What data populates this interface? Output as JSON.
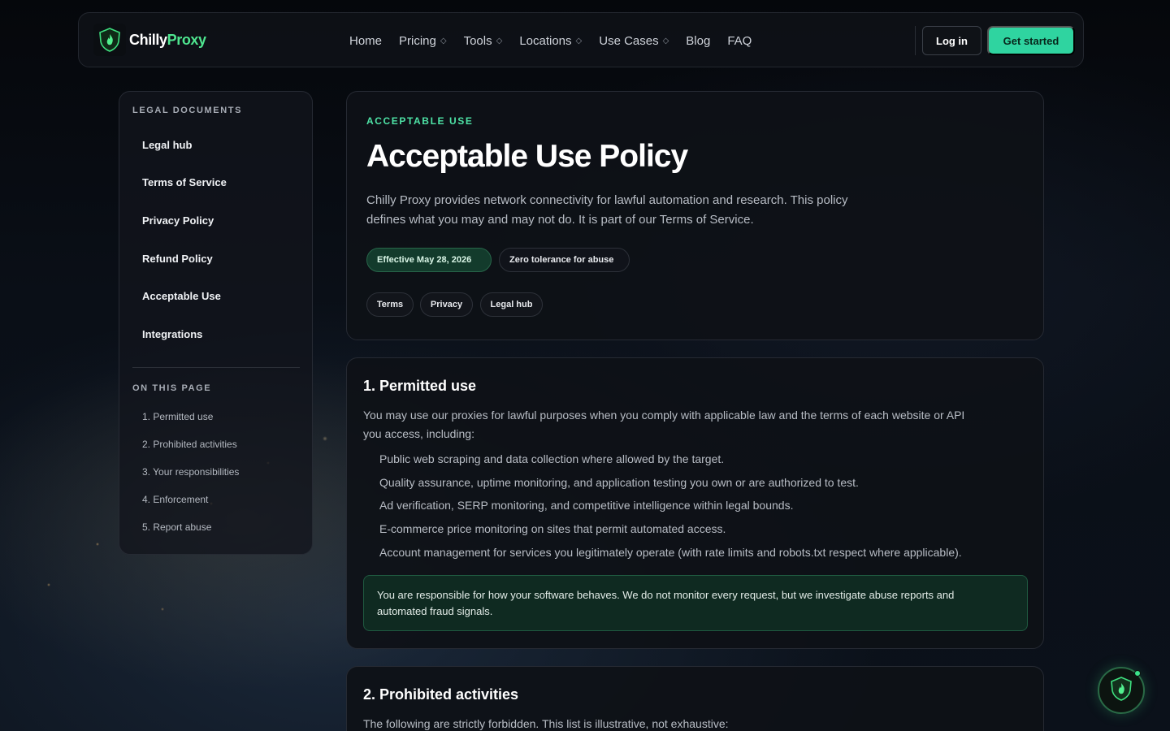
{
  "header": {
    "logo_part1": "Chilly",
    "logo_part2": "Proxy",
    "nav": [
      {
        "label": "Home",
        "dropdown": false
      },
      {
        "label": "Pricing",
        "dropdown": true
      },
      {
        "label": "Tools",
        "dropdown": true
      },
      {
        "label": "Locations",
        "dropdown": true
      },
      {
        "label": "Use Cases",
        "dropdown": true
      },
      {
        "label": "Blog",
        "dropdown": false
      },
      {
        "label": "FAQ",
        "dropdown": false
      }
    ],
    "login_label": "Log in",
    "cta_label": "Get started"
  },
  "sidebar": {
    "docs_heading": "LEGAL DOCUMENTS",
    "docs": [
      "Legal hub",
      "Terms of Service",
      "Privacy Policy",
      "Refund Policy",
      "Acceptable Use",
      "Integrations"
    ],
    "toc_heading": "ON THIS PAGE",
    "toc": [
      "1. Permitted use",
      "2. Prohibited activities",
      "3. Your responsibilities",
      "4. Enforcement",
      "5. Report abuse"
    ]
  },
  "hero": {
    "eyebrow": "ACCEPTABLE USE",
    "title": "Acceptable Use Policy",
    "lead_line1": "Chilly Proxy provides network connectivity for lawful automation and research. This policy",
    "lead_line2": "defines what you may and may not do. It is part of our Terms of Service.",
    "badge_effective": "Effective May 28, 2026",
    "badge_tolerance": "Zero tolerance for abuse",
    "links": [
      "Terms",
      "Privacy",
      "Legal hub"
    ]
  },
  "section1": {
    "title": "1. Permitted use",
    "intro_line1": "You may use our proxies for lawful purposes when you comply with applicable law and the terms of each website or API",
    "intro_line2": "you access, including:",
    "bullets": [
      "Public web scraping and data collection where allowed by the target.",
      "Quality assurance, uptime monitoring, and application testing you own or are authorized to test.",
      "Ad verification, SERP monitoring, and competitive intelligence within legal bounds.",
      "E-commerce price monitoring on sites that permit automated access.",
      "Account management for services you legitimately operate (with rate limits and robots.txt respect where applicable)."
    ],
    "note_line1": "You are responsible for how your software behaves. We do not monitor every request, but we investigate abuse reports and",
    "note_line2": "automated fraud signals."
  },
  "section2": {
    "title": "2. Prohibited activities",
    "intro": "The following are strictly forbidden. This list is illustrative, not exhaustive:"
  },
  "colors": {
    "accent": "#2fd4a0",
    "brand_green": "#4ee58f",
    "background": "#070a10"
  },
  "icons": {
    "logo": "shield-flame-icon",
    "caret": "chevron-down-icon",
    "fab": "shield-flame-icon"
  }
}
